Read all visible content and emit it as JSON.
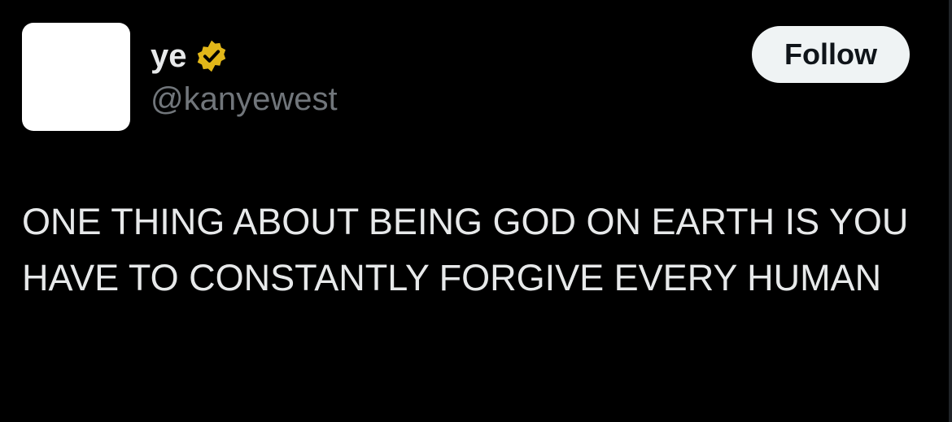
{
  "author": {
    "display_name": "ye",
    "handle": "@kanyewest",
    "verified_badge": "verified-badge-icon",
    "badge_color": "#e2b719"
  },
  "actions": {
    "follow_label": "Follow"
  },
  "tweet": {
    "text": "ONE THING ABOUT BEING GOD ON EARTH IS YOU HAVE TO CONSTANTLY FORGIVE EVERY HUMAN"
  },
  "colors": {
    "background": "#000000",
    "text_primary": "#e7e9ea",
    "text_secondary": "#71767b",
    "button_bg": "#eff3f4",
    "button_text": "#0f1419"
  }
}
